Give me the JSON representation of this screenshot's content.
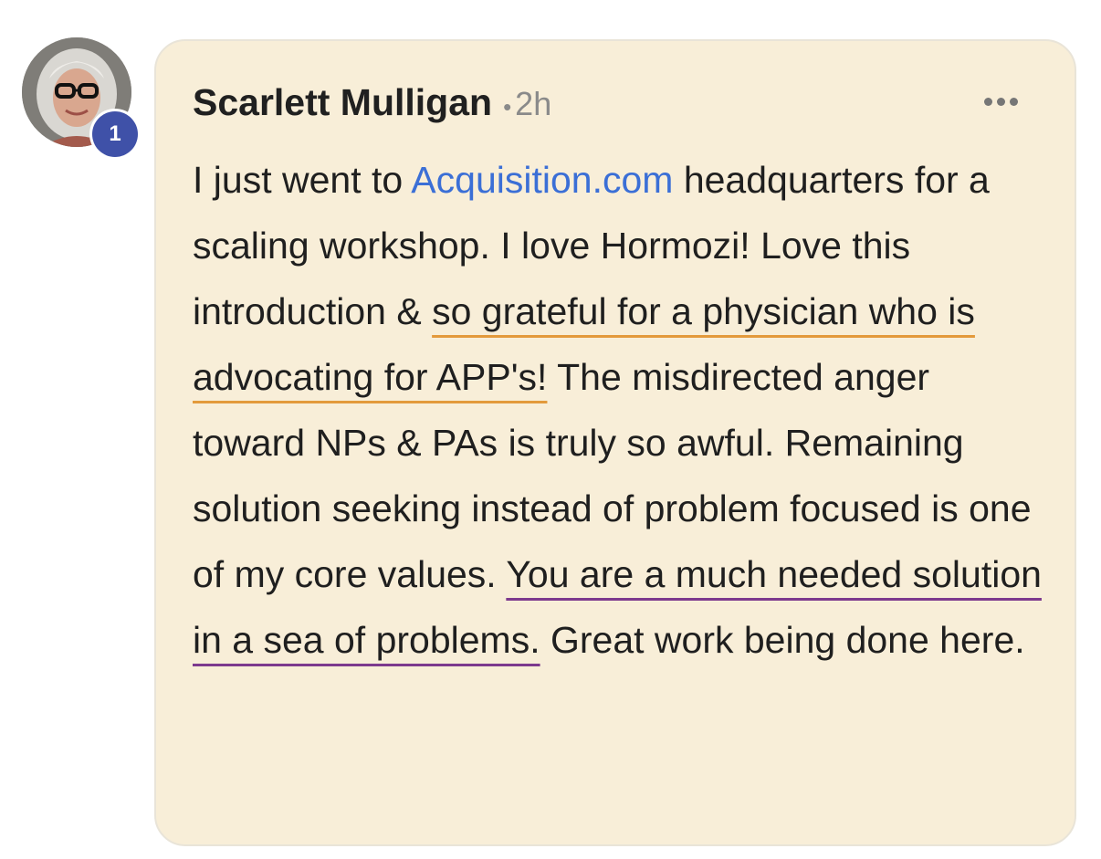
{
  "comment": {
    "author": "Scarlett Mulligan",
    "separator": "•",
    "time": "2h",
    "more_icon": "more-horizontal-icon",
    "badge": "1",
    "body": {
      "seg1": "I just went to ",
      "link": "Acquisition.com",
      "seg2": " headquarters for a scaling workshop. I love Hormozi! Love this introduction & ",
      "highlight_orange": "so grateful for a physician who is advocating for APP's!",
      "seg3": " The misdirected anger toward NPs & PAs is truly so awful. Remaining solution seeking instead of problem focused is one of my core values. ",
      "highlight_purple": "You are a much needed solution in a sea of problems.",
      "seg4": " Great work being done here."
    }
  },
  "colors": {
    "bubble_background": "#f8eed8",
    "link": "#3b6fd6",
    "underline_orange": "#e39a3c",
    "underline_purple": "#7d3a8e",
    "badge": "#3f51a8"
  }
}
